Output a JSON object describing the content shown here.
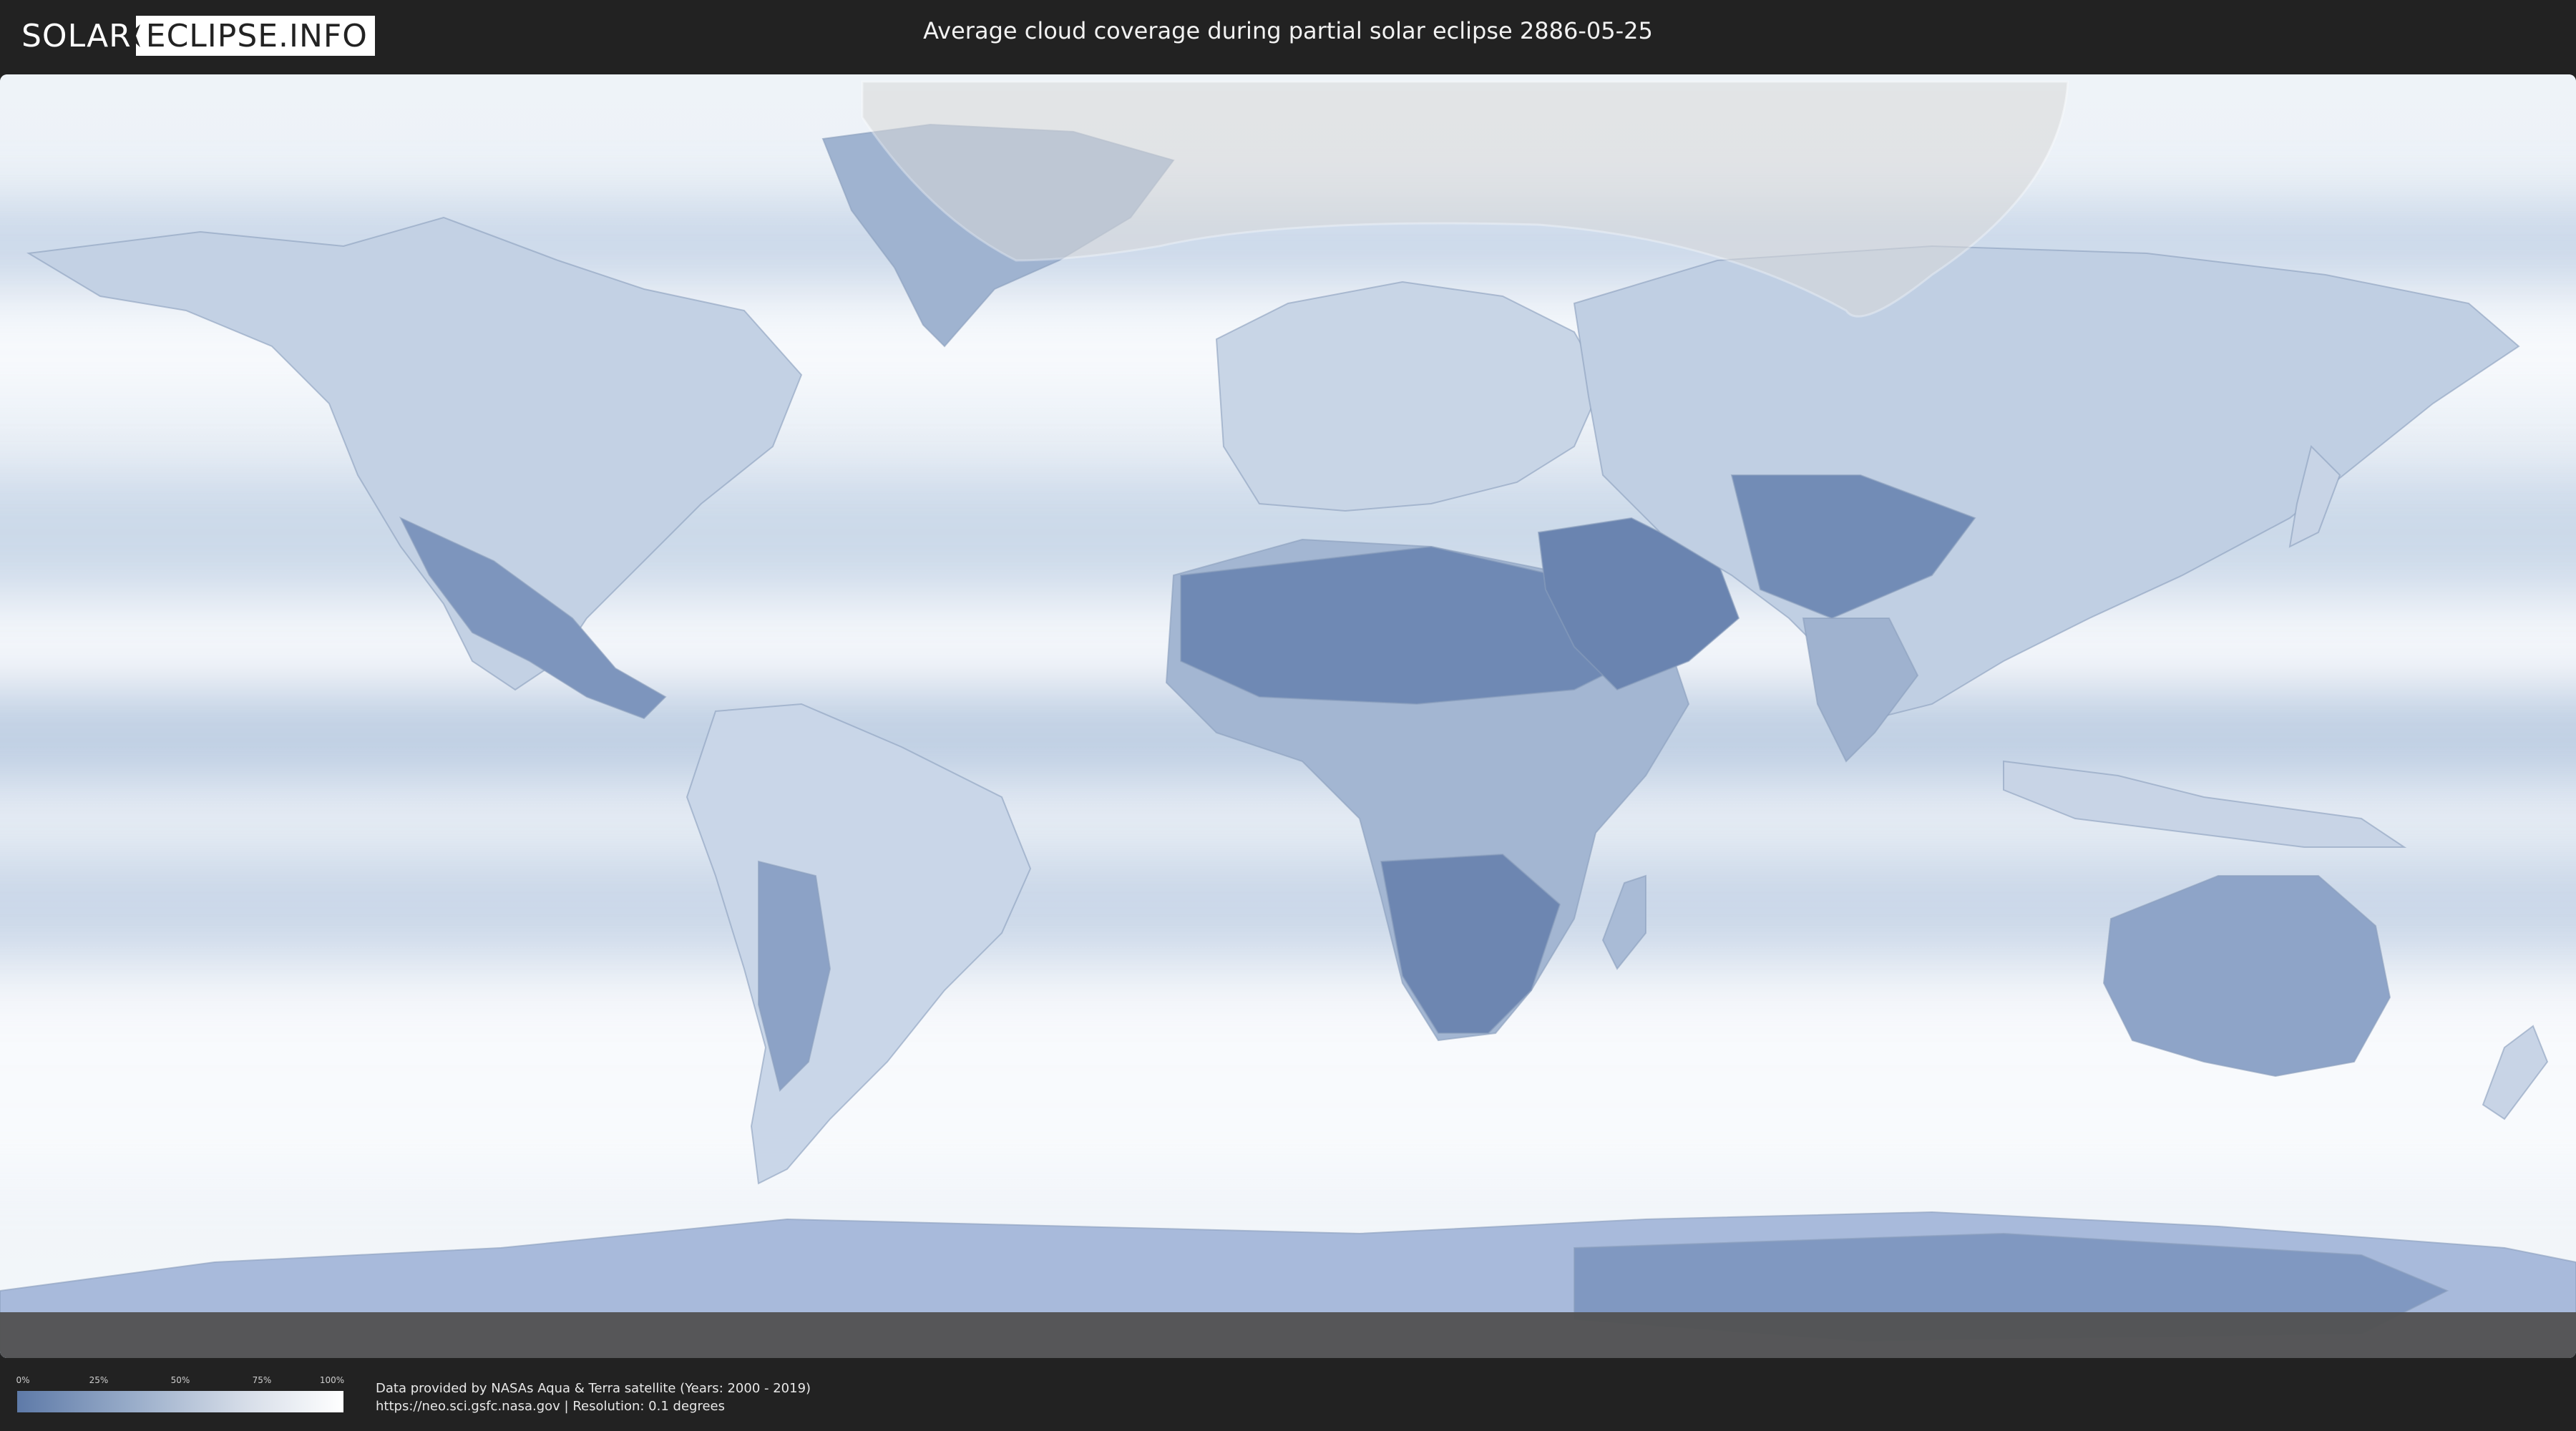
{
  "header": {
    "logo_left": "SOLAR",
    "logo_right": "ECLIPSE.INFO",
    "title": "Average cloud coverage during partial solar eclipse 2886-05-25"
  },
  "map": {
    "icons": [
      "moon-icon"
    ]
  },
  "legend": {
    "ticks": [
      "0%",
      "25%",
      "50%",
      "75%",
      "100%"
    ],
    "colors": {
      "low": "#5e7aa8",
      "high": "#ffffff"
    }
  },
  "credits": {
    "line1": "Data provided by NASAs Aqua & Terra satellite (Years: 2000 - 2019)",
    "line2": "https://neo.sci.gsfc.nasa.gov | Resolution: 0.1 degrees"
  }
}
